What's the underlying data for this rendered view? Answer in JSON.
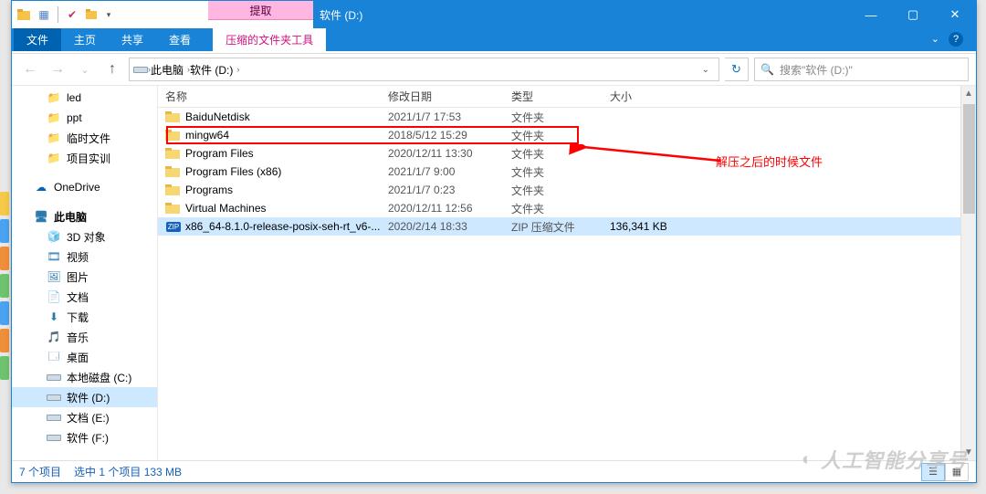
{
  "title": "软件 (D:)",
  "ribbon": {
    "extract_tab_top": "提取",
    "file": "文件",
    "tabs": [
      "主页",
      "共享",
      "查看"
    ],
    "context_tab": "压缩的文件夹工具"
  },
  "breadcrumb": {
    "pc": "此电脑",
    "drive": "软件 (D:)"
  },
  "search": {
    "placeholder": "搜索\"软件 (D:)\""
  },
  "tree": {
    "quick": [
      {
        "label": "led"
      },
      {
        "label": "ppt"
      },
      {
        "label": "临时文件"
      },
      {
        "label": "项目实训"
      }
    ],
    "onedrive": "OneDrive",
    "this_pc": "此电脑",
    "pc_children": [
      {
        "icon": "3d",
        "label": "3D 对象"
      },
      {
        "icon": "video",
        "label": "视频"
      },
      {
        "icon": "images",
        "label": "图片"
      },
      {
        "icon": "docs",
        "label": "文档"
      },
      {
        "icon": "dl",
        "label": "下载"
      },
      {
        "icon": "music",
        "label": "音乐"
      },
      {
        "icon": "desk",
        "label": "桌面"
      },
      {
        "icon": "drive",
        "label": "本地磁盘 (C:)"
      },
      {
        "icon": "drive",
        "label": "软件 (D:)",
        "selected": true
      },
      {
        "icon": "drive",
        "label": "文档 (E:)"
      },
      {
        "icon": "drive",
        "label": "软件 (F:)"
      }
    ]
  },
  "columns": {
    "name": "名称",
    "date": "修改日期",
    "type": "类型",
    "size": "大小"
  },
  "rows": [
    {
      "icon": "folder",
      "name": "BaiduNetdisk",
      "date": "2021/1/7 17:53",
      "type": "文件夹",
      "size": ""
    },
    {
      "icon": "folder",
      "name": "mingw64",
      "date": "2018/5/12 15:29",
      "type": "文件夹",
      "size": "",
      "highlight": true
    },
    {
      "icon": "folder",
      "name": "Program Files",
      "date": "2020/12/11 13:30",
      "type": "文件夹",
      "size": ""
    },
    {
      "icon": "folder",
      "name": "Program Files (x86)",
      "date": "2021/1/7 9:00",
      "type": "文件夹",
      "size": ""
    },
    {
      "icon": "folder",
      "name": "Programs",
      "date": "2021/1/7 0:23",
      "type": "文件夹",
      "size": ""
    },
    {
      "icon": "folder",
      "name": "Virtual Machines",
      "date": "2020/12/11 12:56",
      "type": "文件夹",
      "size": ""
    },
    {
      "icon": "zip",
      "name": "x86_64-8.1.0-release-posix-seh-rt_v6-...",
      "date": "2020/2/14 18:33",
      "type": "ZIP 压缩文件",
      "size": "136,341 KB",
      "selected": true
    }
  ],
  "annotation": "解压之后的时候文件",
  "status": {
    "count": "7 个项目",
    "selection": "选中 1 个项目  133 MB"
  },
  "watermark": "人工智能分享号"
}
